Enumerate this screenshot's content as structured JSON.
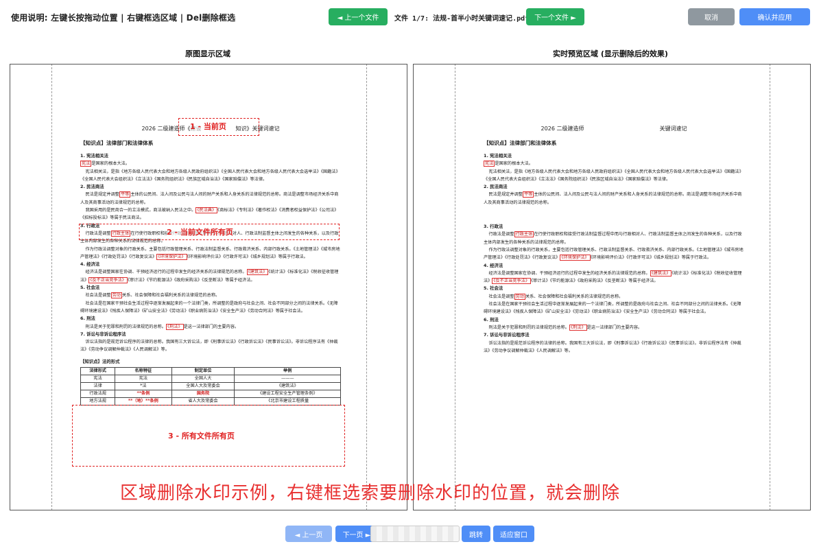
{
  "toolbar": {
    "usage": "使用说明: 左键长按拖动位置 | 右键框选区域 | Del删除框选",
    "prev_file": "◄ 上一个文件",
    "file_label": "文件 1/7: 法规-首半小时关键词速记.pdf",
    "next_file": "下一个文件 ►",
    "cancel": "取消",
    "confirm": "确认并应用"
  },
  "panels": {
    "left_title": "原图显示区域",
    "right_title": "实时预览区域 (显示删除后的效果)"
  },
  "doc": {
    "title_pre": "2026 二级建造师《建设",
    "title_post": "知识》关键词速记",
    "title_preview_left": "2026 二级建造师",
    "title_preview_right": "关键词速记",
    "kp1": "【知识点】法律部门和法律体系",
    "s1_h": "1. 宪法相关法",
    "s1_mark": "宪法",
    "s1_l1": "是国家的根本大法。",
    "s1_p2": "宪法相关法，是指《地方各级人民代表大会和地方各级人民政府组织法》《全国人民代表大会和地方各级人民代表大会选举法》《国籍法》《全国人民代表大会组织法》《立法法》《国务院组织法》《民族区域自治法》《国家赔偿法》等法律。",
    "s2_h": "2. 民法商法",
    "s2_pre": "民法是规定并调整",
    "s2_mark": "平等",
    "s2_post": "主体的公民间、法人间及公民与法人间的财产关系和人身关系的法律规范的总称。商法是调整市场经济关系中商人及其商事活动的法律规范的总称。",
    "s2_p2_pre": "我国采用的是民商合一的立法模式，商法被纳入民法之中。",
    "s2_p2_mark1": "《民法典》",
    "s2_p2_post": "《商标法》《专利法》《著作权法》《消费者权益保护法》《公司法》《招标投标法》等属于民法商法。",
    "s3_h": "3. 行政法",
    "s3_pre": "行政法是调整",
    "s3_mark": "行政主体",
    "s3_post": "在行使行政职权和接受行政法制监督过程中而与行政相对人、行政法制监督主体之间发生的各种关系，以及行政主体内部发生的各种关系的法律规范的总称。",
    "s3_p2_pre": "作为行政法调整对象的行政关系，主要包括行政管理关系、行政法制监督关系、行政救济关系、内部行政关系。《土地管理法》《城市房地产管理法》《行政处罚法》《行政复议法》",
    "s3_p2_mark": "《环境保护法》",
    "s3_p2_post": "《环境影响评价法》《行政许可法》《城乡规划法》等属于行政法。",
    "s4_h": "4. 经济法",
    "s4_pre": "经济法是调整国家在协调、干预经济运行的过程中发生的经济关系的法律规范的总称。",
    "s4_mark1": "《建筑法》",
    "s4_mid": "《统计法》《标准化法》《税收征收管理法》",
    "s4_mark2": "《反不正当竞争法》",
    "s4_post": "《审计法》《节约能源法》《政府采购法》《反垄断法》等属于经济法。",
    "s5_h": "5. 社会法",
    "s5_pre": "社会法是调整",
    "s5_mark": "劳动",
    "s5_post": "关系、社会保障和社会福利关系的法律规范的总称。",
    "s5_p2": "社会法是在国家干预社会生活过程中逐渐发展起来的一个法律门类，所调整的是政府与社会之间、社会不同部分之间的法律关系。《无障碍环境建设法》《残疾人保障法》《矿山安全法》《劳动法》《职业病防治法》《安全生产法》《劳动合同法》等属于社会法。",
    "s6_h": "6. 刑法",
    "s6_pre": "刑法是关于犯罪和刑罚的法律规范的总称。",
    "s6_mark": "《刑法》",
    "s6_post": "是这一法律部门的主要内容。",
    "s7_h": "7. 诉讼与非诉讼程序法",
    "s7_p": "诉讼法指的是规范诉讼程序的法律的总称。我国有三大诉讼法，即《刑事诉讼法》《行政诉讼法》《民事诉讼法》。非诉讼程序法有《仲裁法》《劳动争议调解仲裁法》《人民调解法》等。",
    "kp2": "【知识点】法的形式",
    "table": {
      "headers": [
        "法律形式",
        "名称特征",
        "制定单位",
        "举例"
      ],
      "rows": [
        [
          "宪法",
          "宪法",
          "全国人大",
          "———"
        ],
        [
          "法律",
          "*法",
          "全国人大及常委会",
          "《建筑法》"
        ],
        [
          "行政法规",
          "**条例",
          "国务院",
          "《建设工程安全生产管理条例》"
        ],
        [
          "地方法规",
          "**（地）**条例",
          "省人大及常委会",
          "《北京市建设工程质量"
        ]
      ]
    }
  },
  "annotations": {
    "a1": "1 - 当前页",
    "a2": "2 - 当前文件所有页",
    "a3": "3 - 所有文件所有页"
  },
  "caption": "区域删除水印示例，右键框选索要删除水印的位置，就会删除",
  "bottom": {
    "prev_page": "◄ 上一页",
    "next_page": "下一页 ►",
    "jump": "跳转",
    "fit": "适应窗口"
  }
}
